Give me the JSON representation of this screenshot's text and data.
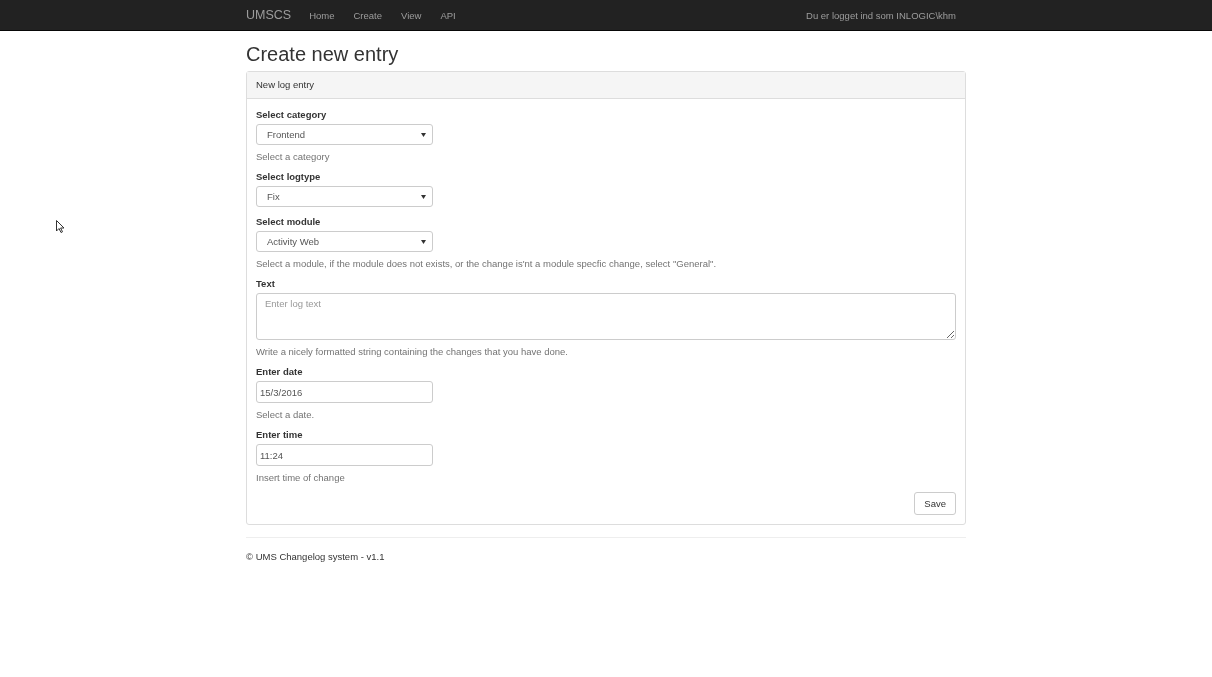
{
  "navbar": {
    "brand": "UMSCS",
    "links": [
      {
        "label": "Home",
        "selected": false
      },
      {
        "label": "Create",
        "selected": false
      },
      {
        "label": "View",
        "selected": false
      },
      {
        "label": "API",
        "selected": false
      }
    ],
    "user": "Du er logget ind som INLOGIC\\khm"
  },
  "page_title": "Create new entry",
  "panel": {
    "heading": "New log entry",
    "fields": [
      {
        "kind": "select",
        "label": "Select category",
        "value": "Frontend",
        "help": "Select a category"
      },
      {
        "kind": "select",
        "label": "Select logtype",
        "value": "Fix"
      },
      {
        "kind": "select",
        "label": "Select module",
        "value": "Activity Web",
        "help": "Select a module, if the module does not exists, or the change is'nt a module specfic change, select \"General\"."
      },
      {
        "kind": "textarea",
        "label": "Text",
        "placeholder": "Enter log text",
        "help": "Write a nicely formatted string containing the changes that you have done."
      },
      {
        "kind": "input",
        "label": "Enter date",
        "value": "15/3/2016",
        "help": "Select a date."
      },
      {
        "kind": "input",
        "label": "Enter time",
        "value": "11:24",
        "help": "Insert time of change"
      }
    ],
    "button": "Save"
  },
  "footer": "© UMS Changelog system - v1.1"
}
